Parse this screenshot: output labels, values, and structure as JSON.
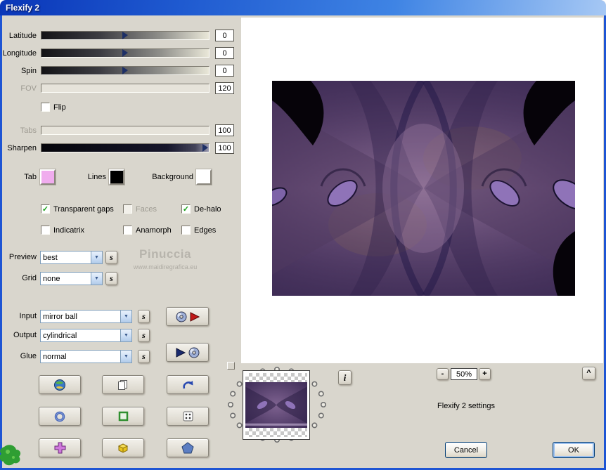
{
  "window": {
    "title": "Flexify 2"
  },
  "icons": {
    "check": "✓",
    "dropdown_arrow": "▼"
  },
  "panel": {
    "sliders": [
      {
        "label": "Latitude",
        "value": "0",
        "disabled": false
      },
      {
        "label": "Longitude",
        "value": "0",
        "disabled": false
      },
      {
        "label": "Spin",
        "value": "0",
        "disabled": false
      },
      {
        "label": "FOV",
        "value": "120",
        "disabled": true
      },
      {
        "label": "Tabs",
        "value": "100",
        "disabled": true
      },
      {
        "label": "Sharpen",
        "value": "100",
        "disabled": false
      }
    ],
    "flip_label": "Flip",
    "colors": [
      {
        "label": "Tab",
        "color": "#f0acee"
      },
      {
        "label": "Lines",
        "color": "#000000"
      },
      {
        "label": "Background",
        "color": "#ffffff"
      }
    ],
    "checkboxes": [
      {
        "label": "Transparent gaps",
        "checked": true,
        "disabled": false
      },
      {
        "label": "Faces",
        "checked": false,
        "disabled": true
      },
      {
        "label": "De-halo",
        "checked": true,
        "disabled": false
      },
      {
        "label": "Indicatrix",
        "checked": false,
        "disabled": false
      },
      {
        "label": "Anamorph",
        "checked": false,
        "disabled": false
      },
      {
        "label": "Edges",
        "checked": false,
        "disabled": false
      }
    ],
    "dropdowns": [
      {
        "label": "Preview",
        "value": "best"
      },
      {
        "label": "Grid",
        "value": "none"
      },
      {
        "label": "Input",
        "value": "mirror ball"
      },
      {
        "label": "Output",
        "value": "cylindrical"
      },
      {
        "label": "Glue",
        "value": "normal"
      }
    ],
    "shuffle_label": "s",
    "watermark": {
      "line1": "Pinuccia",
      "line2": "www.maidiregrafica.eu"
    }
  },
  "bottom": {
    "zoom_out": "-",
    "zoom_value": "50%",
    "zoom_in": "+",
    "info_label": "i",
    "collapse_label": "^",
    "settings_label": "Flexify 2 settings",
    "cancel_label": "Cancel",
    "ok_label": "OK"
  }
}
